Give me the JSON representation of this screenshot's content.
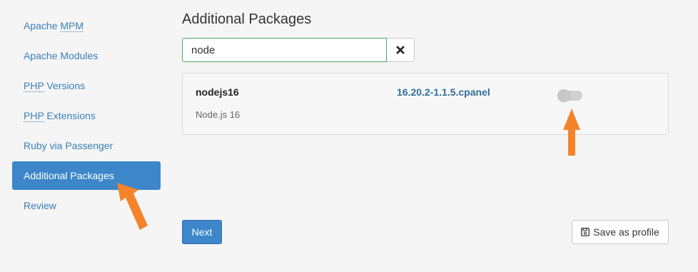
{
  "sidebar": {
    "items": [
      {
        "label_a": "Apache ",
        "label_abbr": "MPM",
        "label_b": ""
      },
      {
        "label_a": "Apache Modules",
        "label_abbr": "",
        "label_b": ""
      },
      {
        "label_a": "",
        "label_abbr": "PHP",
        "label_b": " Versions"
      },
      {
        "label_a": "",
        "label_abbr": "PHP",
        "label_b": " Extensions"
      },
      {
        "label_a": "Ruby via Passenger",
        "label_abbr": "",
        "label_b": ""
      },
      {
        "label_a": "Additional Packages",
        "label_abbr": "",
        "label_b": ""
      },
      {
        "label_a": "Review",
        "label_abbr": "",
        "label_b": ""
      }
    ],
    "active_index": 5
  },
  "main": {
    "title": "Additional Packages",
    "search": {
      "value": "node",
      "clear_icon": "close-icon"
    },
    "packages": [
      {
        "name": "nodejs16",
        "description": "Node.js 16",
        "version": "16.20.2-1.1.5.cpanel",
        "enabled": false
      }
    ],
    "next_label": "Next",
    "save_label": "Save as profile",
    "save_icon": "floppy-disk-icon"
  },
  "colors": {
    "accent": "#3c86c9",
    "link": "#3a7fb8",
    "annotation_arrow": "#f5832a",
    "search_border": "#4ea76a"
  }
}
